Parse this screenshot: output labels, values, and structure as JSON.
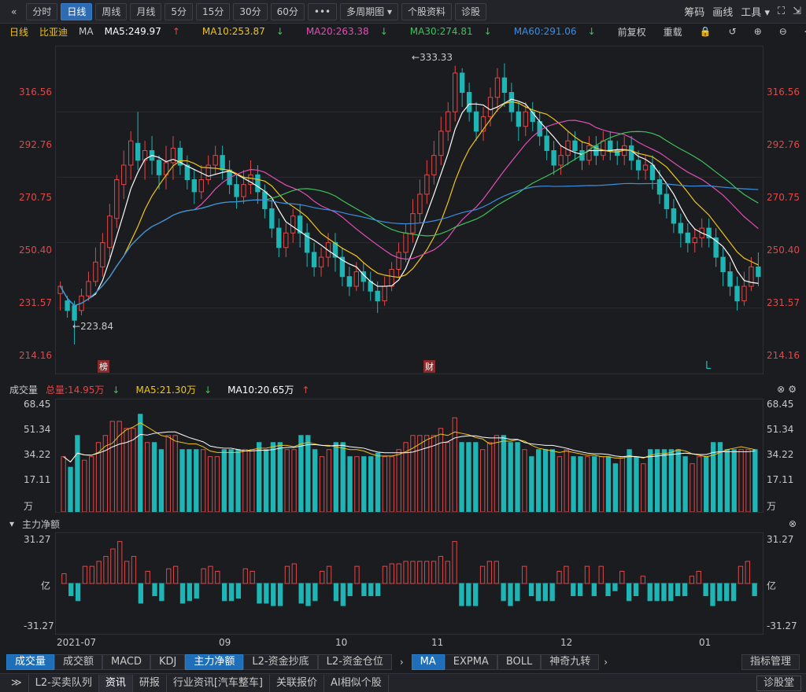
{
  "toolbar": {
    "back_icon": "«",
    "tabs": [
      "分时",
      "日线",
      "周线",
      "月线",
      "5分",
      "15分",
      "30分",
      "60分"
    ],
    "active_tab": "日线",
    "more": "•••",
    "multi_period": "多周期图",
    "stock_info": "个股资料",
    "diagnose": "诊股",
    "right": {
      "chips": "筹码",
      "draw": "画线",
      "tools": "工具"
    }
  },
  "ma_bar": {
    "period": "日线",
    "name": "比亚迪",
    "type": "MA",
    "ma5": "MA5:249.97",
    "ma10": "MA10:253.87",
    "ma20": "MA20:263.38",
    "ma30": "MA30:274.81",
    "ma60": "MA60:291.06",
    "adjust": "前复权",
    "reset": "重载"
  },
  "colors": {
    "up": "#e04848",
    "down": "#1fb5b5",
    "ma5": "#ffffff",
    "ma10": "#f0c419",
    "ma20": "#e04fb5",
    "ma30": "#3ec25a",
    "ma60": "#3a8fe0"
  },
  "price_axis": [
    "316.56",
    "292.76",
    "270.75",
    "250.40",
    "231.57",
    "214.16"
  ],
  "price_annot": {
    "high": "333.33",
    "low": "223.84"
  },
  "markers": {
    "rank": "榜",
    "finance": "财",
    "l": "L"
  },
  "volume": {
    "title": "成交量",
    "total": "总量:14.95万",
    "ma5": "MA5:21.30万",
    "ma10": "MA10:20.65万",
    "axis": [
      "68.45",
      "51.34",
      "34.22",
      "17.11",
      "万"
    ]
  },
  "netflow": {
    "title": "主力净额",
    "axis": [
      "31.27",
      "亿",
      "-31.27"
    ]
  },
  "date_axis": [
    "2021-07",
    "09",
    "10",
    "11",
    "12",
    "01"
  ],
  "bottom_tabs": [
    "成交量",
    "成交额",
    "MACD",
    "KDJ",
    "主力净额",
    "L2-资金抄底",
    "L2-资金仓位",
    "MA",
    "EXPMA",
    "BOLL",
    "神奇九转"
  ],
  "bottom_active": [
    "成交量",
    "主力净额",
    "MA"
  ],
  "indicator_mgr": "指标管理",
  "status_tabs": [
    "L2-买卖队列",
    "资讯",
    "研报",
    "行业资讯[汽车整车]",
    "关联报价",
    "AI相似个股"
  ],
  "status_active": "资讯",
  "status_right": "诊股堂",
  "chart_data": {
    "type": "candlestick",
    "ylim": [
      210,
      345
    ],
    "candles": [
      [
        243,
        246,
        236,
        248
      ],
      [
        240,
        236,
        233,
        242
      ],
      [
        238,
        232,
        222,
        240
      ],
      [
        236,
        242,
        234,
        245
      ],
      [
        242,
        248,
        240,
        252
      ],
      [
        248,
        256,
        246,
        262
      ],
      [
        254,
        264,
        250,
        268
      ],
      [
        262,
        275,
        258,
        280
      ],
      [
        274,
        290,
        270,
        292
      ],
      [
        288,
        296,
        282,
        302
      ],
      [
        296,
        306,
        290,
        310
      ],
      [
        305,
        298,
        294,
        318
      ],
      [
        298,
        302,
        290,
        306
      ],
      [
        302,
        298,
        292,
        308
      ],
      [
        298,
        292,
        286,
        300
      ],
      [
        292,
        297,
        286,
        304
      ],
      [
        297,
        303,
        290,
        308
      ],
      [
        303,
        296,
        292,
        306
      ],
      [
        296,
        290,
        286,
        300
      ],
      [
        290,
        285,
        280,
        294
      ],
      [
        285,
        290,
        282,
        296
      ],
      [
        290,
        296,
        288,
        300
      ],
      [
        296,
        300,
        292,
        304
      ],
      [
        300,
        294,
        290,
        304
      ],
      [
        294,
        288,
        284,
        298
      ],
      [
        288,
        283,
        278,
        292
      ],
      [
        283,
        288,
        280,
        294
      ],
      [
        288,
        292,
        284,
        298
      ],
      [
        292,
        285,
        280,
        296
      ],
      [
        285,
        278,
        274,
        288
      ],
      [
        278,
        270,
        266,
        282
      ],
      [
        270,
        262,
        258,
        274
      ],
      [
        262,
        268,
        258,
        272
      ],
      [
        268,
        275,
        264,
        278
      ],
      [
        275,
        268,
        262,
        280
      ],
      [
        268,
        260,
        254,
        272
      ],
      [
        260,
        254,
        250,
        264
      ],
      [
        254,
        258,
        250,
        262
      ],
      [
        258,
        264,
        254,
        268
      ],
      [
        264,
        258,
        252,
        268
      ],
      [
        258,
        250,
        246,
        262
      ],
      [
        250,
        246,
        242,
        254
      ],
      [
        246,
        252,
        244,
        256
      ],
      [
        252,
        248,
        244,
        256
      ],
      [
        248,
        244,
        240,
        252
      ],
      [
        244,
        240,
        235,
        248
      ],
      [
        240,
        246,
        238,
        250
      ],
      [
        246,
        253,
        244,
        256
      ],
      [
        253,
        260,
        250,
        264
      ],
      [
        260,
        268,
        256,
        272
      ],
      [
        268,
        276,
        264,
        282
      ],
      [
        276,
        284,
        272,
        290
      ],
      [
        284,
        292,
        280,
        298
      ],
      [
        292,
        300,
        288,
        306
      ],
      [
        300,
        310,
        296,
        316
      ],
      [
        310,
        318,
        306,
        322
      ],
      [
        318,
        334,
        314,
        337
      ],
      [
        334,
        326,
        320,
        336
      ],
      [
        326,
        318,
        314,
        330
      ],
      [
        318,
        310,
        306,
        322
      ],
      [
        310,
        316,
        306,
        320
      ],
      [
        316,
        324,
        312,
        328
      ],
      [
        324,
        332,
        318,
        336
      ],
      [
        332,
        326,
        320,
        338
      ],
      [
        326,
        318,
        314,
        330
      ],
      [
        318,
        312,
        306,
        322
      ],
      [
        312,
        318,
        308,
        322
      ],
      [
        318,
        314,
        310,
        322
      ],
      [
        314,
        308,
        304,
        318
      ],
      [
        308,
        302,
        298,
        312
      ],
      [
        302,
        296,
        292,
        306
      ],
      [
        296,
        300,
        292,
        304
      ],
      [
        300,
        306,
        296,
        310
      ],
      [
        306,
        302,
        298,
        310
      ],
      [
        302,
        298,
        294,
        306
      ],
      [
        298,
        304,
        296,
        308
      ],
      [
        304,
        300,
        296,
        308
      ],
      [
        300,
        306,
        298,
        310
      ],
      [
        306,
        302,
        298,
        310
      ],
      [
        302,
        300,
        296,
        306
      ],
      [
        300,
        304,
        296,
        308
      ],
      [
        304,
        298,
        294,
        308
      ],
      [
        298,
        294,
        290,
        302
      ],
      [
        294,
        296,
        290,
        300
      ],
      [
        296,
        290,
        286,
        300
      ],
      [
        290,
        284,
        280,
        294
      ],
      [
        284,
        278,
        274,
        288
      ],
      [
        278,
        272,
        268,
        282
      ],
      [
        272,
        268,
        262,
        276
      ],
      [
        268,
        264,
        260,
        272
      ],
      [
        264,
        266,
        260,
        270
      ],
      [
        266,
        270,
        262,
        274
      ],
      [
        270,
        266,
        262,
        274
      ],
      [
        266,
        258,
        254,
        270
      ],
      [
        258,
        252,
        246,
        262
      ],
      [
        252,
        246,
        242,
        256
      ],
      [
        246,
        240,
        236,
        250
      ],
      [
        240,
        246,
        238,
        252
      ],
      [
        246,
        254,
        244,
        258
      ],
      [
        254,
        250,
        246,
        260
      ]
    ]
  }
}
